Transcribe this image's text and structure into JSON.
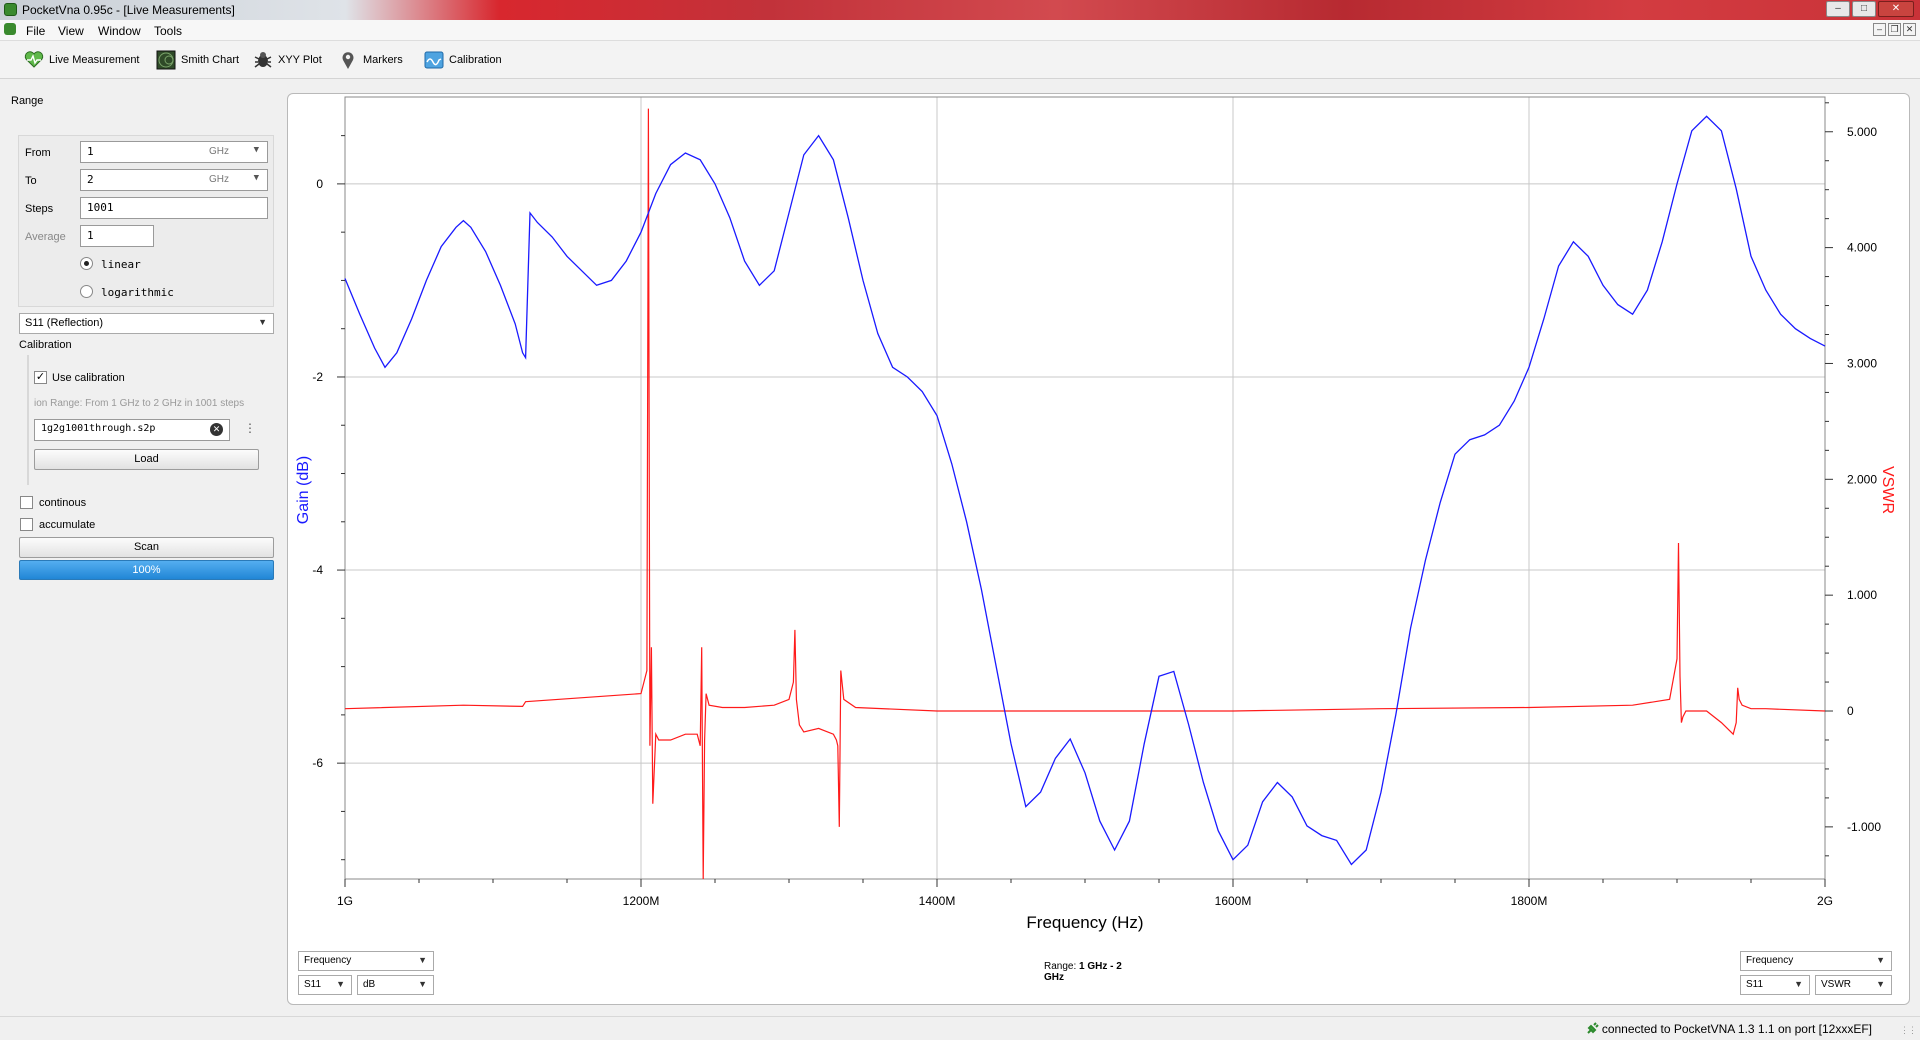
{
  "window": {
    "title": "PocketVna 0.95c - [Live Measurements]"
  },
  "menu": [
    "File",
    "View",
    "Window",
    "Tools"
  ],
  "toolbar": [
    {
      "label": "Live Measurement",
      "icon": "heart-pulse-icon"
    },
    {
      "label": "Smith Chart",
      "icon": "smith-chart-icon"
    },
    {
      "label": "XYY Plot",
      "icon": "bug-icon"
    },
    {
      "label": "Markers",
      "icon": "marker-pin-icon"
    },
    {
      "label": "Calibration",
      "icon": "calibration-icon"
    }
  ],
  "range": {
    "title": "Range",
    "from_label": "From",
    "from_value": "1",
    "from_unit": "GHz",
    "to_label": "To",
    "to_value": "2",
    "to_unit": "GHz",
    "steps_label": "Steps",
    "steps_value": "1001",
    "average_label": "Average",
    "average_value": "1",
    "scale_linear": "linear",
    "scale_log": "logarithmic",
    "scale_selected": "linear"
  },
  "param_select": "S11 (Reflection)",
  "calibration": {
    "title": "Calibration",
    "use_label": "Use calibration",
    "use_checked": true,
    "info": "ion Range: From 1 GHz to 2 GHz in 1001 steps",
    "file": "1g2g1001through.s2p",
    "load_label": "Load"
  },
  "options": {
    "continous": "continous",
    "accumulate": "accumulate"
  },
  "scan_label": "Scan",
  "progress": {
    "text": "100%",
    "value": 100
  },
  "bottom": {
    "left_xsel": "Frequency",
    "left_param": "S11",
    "left_unit": "dB",
    "range_label": "Range:",
    "range_value": "1 GHz - 2",
    "range_unit": "GHz",
    "right_xsel": "Frequency",
    "right_param": "S11",
    "right_unit": "VSWR"
  },
  "status": {
    "text": "connected to PocketVNA 1.3 1.1 on port [12xxxEF]"
  },
  "chart_data": {
    "type": "line",
    "xlabel": "Frequency (Hz)",
    "ylabel_left": "Gain (dB)",
    "ylabel_right": "VSWR",
    "x_ticks": [
      "1G",
      "1200M",
      "1400M",
      "1600M",
      "1800M",
      "2G"
    ],
    "x_range_mhz": [
      1000,
      2000
    ],
    "y_left_ticks": [
      "0",
      "-2",
      "-4",
      "-6"
    ],
    "y_left_range": [
      -7.2,
      0.9
    ],
    "y_right_ticks": [
      "5.000",
      "4.000",
      "3.000",
      "2.000",
      "1.000",
      "0",
      "-1.000"
    ],
    "y_right_range": [
      -1.45,
      5.3
    ],
    "colors": {
      "gain": "#1a1aff",
      "vswr": "#ff1a1a"
    },
    "series": [
      {
        "name": "Gain (dB)",
        "axis": "left",
        "x_mhz": [
          1000,
          1010,
          1020,
          1027,
          1035,
          1045,
          1055,
          1065,
          1075,
          1080,
          1085,
          1095,
          1105,
          1115,
          1120,
          1122,
          1125,
          1130,
          1140,
          1150,
          1160,
          1170,
          1180,
          1190,
          1200,
          1210,
          1220,
          1230,
          1240,
          1250,
          1260,
          1270,
          1280,
          1290,
          1300,
          1310,
          1320,
          1330,
          1340,
          1350,
          1360,
          1370,
          1380,
          1390,
          1400,
          1410,
          1420,
          1430,
          1440,
          1450,
          1460,
          1470,
          1480,
          1490,
          1500,
          1510,
          1520,
          1530,
          1540,
          1550,
          1560,
          1570,
          1580,
          1590,
          1600,
          1610,
          1620,
          1630,
          1640,
          1650,
          1660,
          1670,
          1680,
          1690,
          1700,
          1710,
          1720,
          1730,
          1740,
          1750,
          1760,
          1770,
          1780,
          1790,
          1800,
          1810,
          1820,
          1830,
          1840,
          1850,
          1860,
          1870,
          1880,
          1890,
          1900,
          1910,
          1920,
          1930,
          1940,
          1950,
          1960,
          1970,
          1980,
          1990,
          2000
        ],
        "values": [
          -0.98,
          -1.35,
          -1.7,
          -1.9,
          -1.75,
          -1.4,
          -1.0,
          -0.65,
          -0.45,
          -0.38,
          -0.45,
          -0.7,
          -1.05,
          -1.45,
          -1.75,
          -1.8,
          -0.3,
          -0.4,
          -0.55,
          -0.75,
          -0.9,
          -1.05,
          -1.0,
          -0.8,
          -0.5,
          -0.1,
          0.2,
          0.32,
          0.25,
          0.0,
          -0.35,
          -0.8,
          -1.05,
          -0.9,
          -0.3,
          0.3,
          0.5,
          0.25,
          -0.35,
          -1.0,
          -1.55,
          -1.9,
          -2.0,
          -2.15,
          -2.4,
          -2.9,
          -3.5,
          -4.2,
          -5.0,
          -5.8,
          -6.45,
          -6.3,
          -5.95,
          -5.75,
          -6.1,
          -6.6,
          -6.9,
          -6.6,
          -5.8,
          -5.1,
          -5.05,
          -5.6,
          -6.2,
          -6.7,
          -7.0,
          -6.85,
          -6.4,
          -6.2,
          -6.35,
          -6.65,
          -6.75,
          -6.8,
          -7.05,
          -6.9,
          -6.3,
          -5.5,
          -4.6,
          -3.9,
          -3.3,
          -2.8,
          -2.65,
          -2.6,
          -2.5,
          -2.25,
          -1.9,
          -1.4,
          -0.85,
          -0.6,
          -0.75,
          -1.05,
          -1.25,
          -1.35,
          -1.1,
          -0.6,
          0.0,
          0.55,
          0.7,
          0.55,
          -0.05,
          -0.75,
          -1.1,
          -1.35,
          -1.5,
          -1.6,
          -1.68
        ]
      },
      {
        "name": "VSWR",
        "axis": "right",
        "x_mhz": [
          1000,
          1080,
          1120,
          1122,
          1200,
          1204,
          1205,
          1206,
          1207,
          1208,
          1210,
          1212,
          1220,
          1230,
          1238,
          1240,
          1241,
          1242,
          1243,
          1244,
          1246,
          1255,
          1270,
          1290,
          1300,
          1303,
          1304,
          1305,
          1307,
          1310,
          1320,
          1330,
          1332,
          1333,
          1334,
          1335,
          1337,
          1345,
          1400,
          1500,
          1600,
          1700,
          1800,
          1870,
          1895,
          1900,
          1901,
          1902,
          1903,
          1904,
          1906,
          1910,
          1920,
          1930,
          1938,
          1940,
          1941,
          1942,
          1944,
          1950,
          1960,
          2000
        ],
        "values": [
          0.02,
          0.05,
          0.04,
          0.08,
          0.15,
          0.35,
          5.2,
          -0.3,
          0.55,
          -0.8,
          -0.2,
          -0.25,
          -0.25,
          -0.2,
          -0.2,
          -0.3,
          0.55,
          -1.45,
          -0.25,
          0.15,
          0.05,
          0.03,
          0.03,
          0.05,
          0.1,
          0.25,
          0.7,
          0.1,
          -0.12,
          -0.18,
          -0.15,
          -0.2,
          -0.25,
          -0.3,
          -1.0,
          0.35,
          0.1,
          0.03,
          0.0,
          0.0,
          0.0,
          0.02,
          0.03,
          0.05,
          0.1,
          0.45,
          1.45,
          0.3,
          -0.1,
          -0.05,
          0.0,
          0.0,
          0.0,
          -0.1,
          -0.2,
          -0.1,
          0.2,
          0.1,
          0.05,
          0.02,
          0.02,
          0.0
        ]
      }
    ]
  }
}
